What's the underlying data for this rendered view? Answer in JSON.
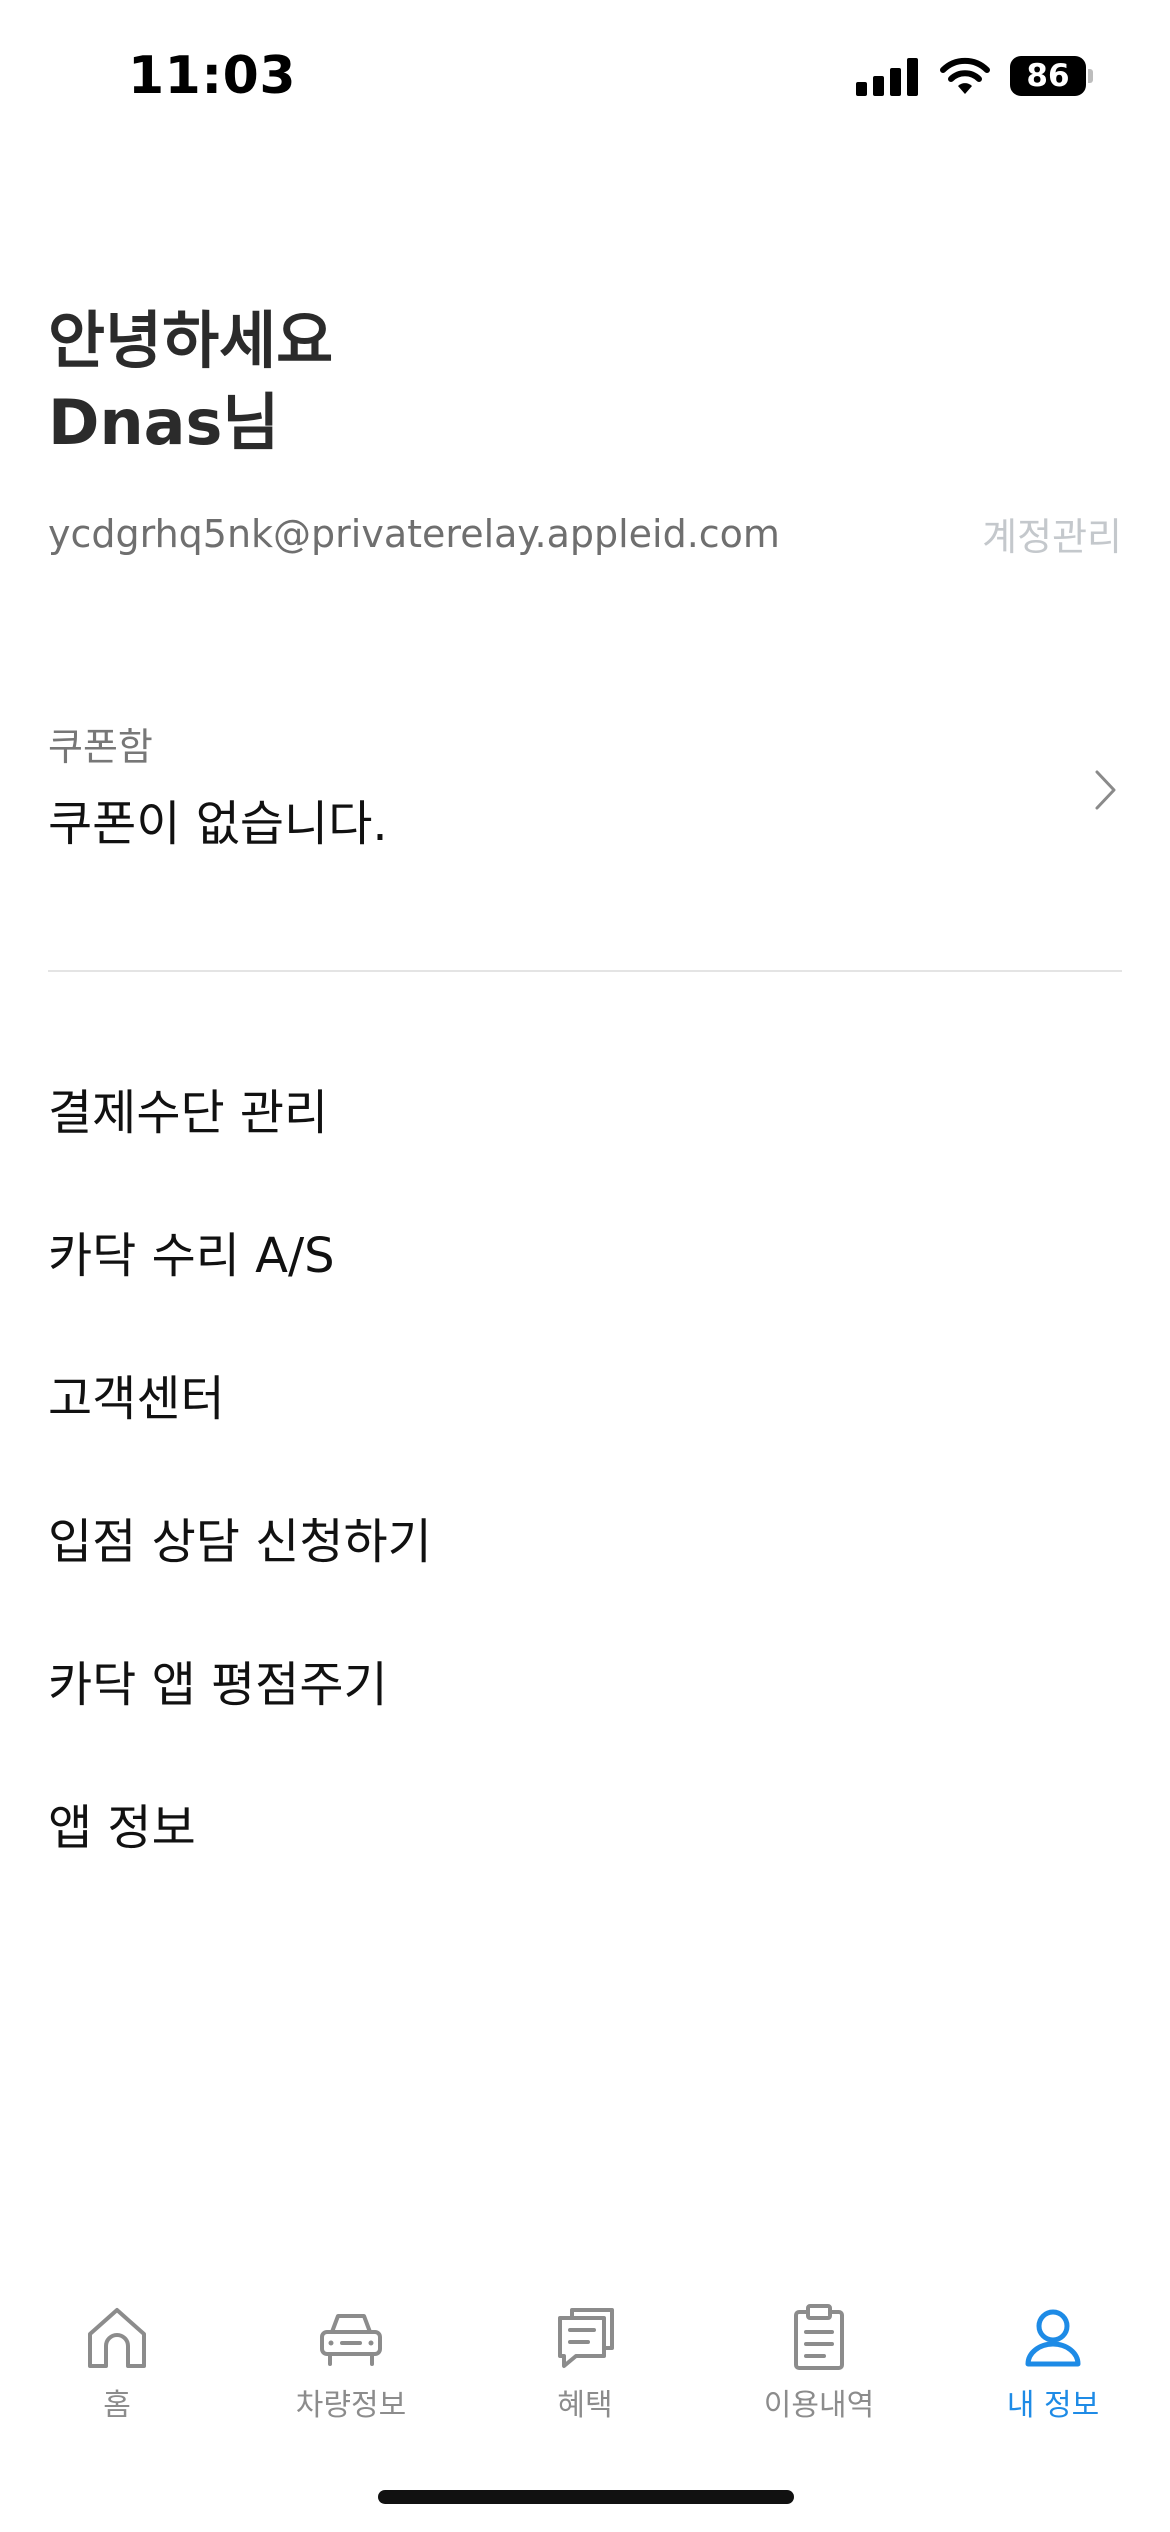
{
  "status_bar": {
    "time": "11:03",
    "battery": "86"
  },
  "greeting": {
    "line1": "안녕하세요",
    "line2": "Dnas님"
  },
  "account": {
    "email": "ycdgrhq5nk@privaterelay.appleid.com",
    "manage_label": "계정관리"
  },
  "coupon": {
    "label": "쿠폰함",
    "value": "쿠폰이 없습니다."
  },
  "menu": {
    "items": [
      {
        "label": "결제수단 관리"
      },
      {
        "label": "카닥 수리 A/S"
      },
      {
        "label": "고객센터"
      },
      {
        "label": "입점 상담 신청하기"
      },
      {
        "label": "카닥 앱 평점주기"
      },
      {
        "label": "앱 정보"
      }
    ]
  },
  "tabbar": {
    "items": [
      {
        "label": "홈",
        "icon": "home-icon"
      },
      {
        "label": "차량정보",
        "icon": "car-icon"
      },
      {
        "label": "혜택",
        "icon": "chat-document-icon"
      },
      {
        "label": "이용내역",
        "icon": "clipboard-icon"
      },
      {
        "label": "내 정보",
        "icon": "person-icon"
      }
    ],
    "active_index": 4
  },
  "colors": {
    "accent": "#1e8be6",
    "inactive": "#8c8c8c",
    "divider": "#e4e4e4"
  }
}
